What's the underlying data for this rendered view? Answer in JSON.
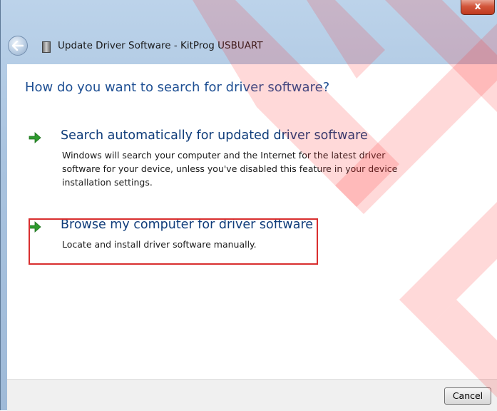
{
  "window": {
    "title": "Update Driver Software - KitProg USBUART",
    "close_label": "x"
  },
  "main": {
    "heading": "How do you want to search for driver software?",
    "options": [
      {
        "title": "Search automatically for updated driver software",
        "description": "Windows will search your computer and the Internet for the latest driver software for your device, unless you've disabled this feature in your device installation settings."
      },
      {
        "title": "Browse my computer for driver software",
        "description": "Locate and install driver software manually."
      }
    ]
  },
  "footer": {
    "cancel_label": "Cancel"
  },
  "colors": {
    "heading": "#1e4f93",
    "option_title": "#0f3c7a",
    "arrow": "#2e9a2e",
    "highlight": "#d92f2f",
    "overlay": "#ff2a2a"
  },
  "icons": {
    "back": "back-arrow-icon",
    "device": "usb-device-icon",
    "option": "green-arrow-icon"
  }
}
